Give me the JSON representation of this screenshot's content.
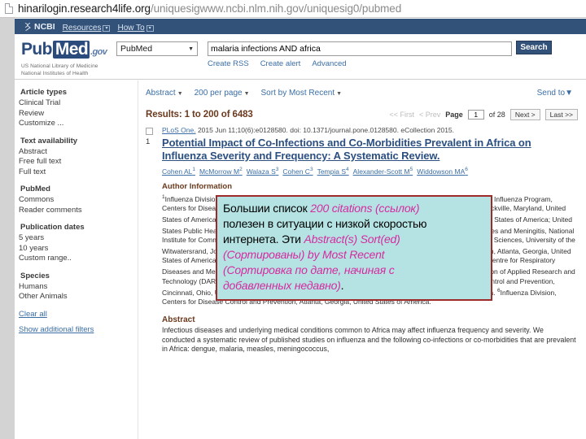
{
  "browser": {
    "url_strong": "hinarilogin.research4life.org",
    "url_dim": "/uniquesigwww.ncbi.nlm.nih.gov/uniquesig0/pubmed",
    "page_icon": "page-icon"
  },
  "ncbi_bar": {
    "logo_text": "NCBI",
    "links": [
      {
        "label": "Resources",
        "caret": "▼"
      },
      {
        "label": "How To",
        "caret": "▼"
      }
    ]
  },
  "header": {
    "logo": {
      "pub": "Pub",
      "med": "Med",
      "gov": ".gov",
      "sub_line1": "US National Library of Medicine",
      "sub_line2": "National Institutes of Health"
    },
    "database_select": {
      "value": "PubMed",
      "caret": "▼"
    },
    "search": {
      "value": "malaria infections AND africa",
      "placeholder": "Search PubMed"
    },
    "search_button": "Search",
    "sub_links": [
      "Create RSS",
      "Create alert",
      "Advanced"
    ]
  },
  "sidebar": {
    "groups": [
      {
        "heading": "Article types",
        "items": [
          "Clinical Trial",
          "Review",
          "Customize ..."
        ]
      },
      {
        "heading": "Text availability",
        "items": [
          "Abstract",
          "Free full text",
          "Full text"
        ]
      },
      {
        "heading": "PubMed",
        "items": [
          "Commons",
          "Reader comments"
        ]
      },
      {
        "heading": "Publication dates",
        "items": [
          "5 years",
          "10 years",
          "Custom range.."
        ]
      },
      {
        "heading": "Species",
        "items": [
          "Humans",
          "Other Animals"
        ]
      }
    ],
    "clear_all": "Clear all",
    "show_additional": "Show additional filters"
  },
  "toolbar": {
    "display_format": "Abstract",
    "per_page": "200 per page",
    "sort_by": "Sort by Most Recent",
    "send_to": "Send to",
    "caret": "▼"
  },
  "results": {
    "count_text": "Results: 1 to 200 of 6483",
    "pager": {
      "first": "<< First",
      "prev": "< Prev",
      "page_label": "Page",
      "page_value": "1",
      "of_text": "of 28",
      "next": "Next >",
      "last": "Last >>"
    }
  },
  "article": {
    "number": "1",
    "journal_name": "PLoS One.",
    "journal_rest": " 2015 Jun 11;10(6):e0128580. doi: 10.1371/journal.pone.0128580. eCollection 2015.",
    "title": "Potential Impact of Co-Infections and Co-Morbidities Prevalent in Africa on Influenza Severity and Frequency: A Systematic Review.",
    "authors": [
      {
        "name": "Cohen AL",
        "sup": "1"
      },
      {
        "name": "McMorrow M",
        "sup": "2"
      },
      {
        "name": "Walaza S",
        "sup": "3"
      },
      {
        "name": "Cohen C",
        "sup": "3"
      },
      {
        "name": "Tempia S",
        "sup": "4"
      },
      {
        "name": "Alexander-Scott M",
        "sup": "5"
      },
      {
        "name": "Widdowson MA",
        "sup": "6"
      }
    ],
    "author_info_heading": "Author Information",
    "affiliations": [
      {
        "sup": "1",
        "text": "Influenza Division, Centers for Disease Control and Prevention, Atlanta, Georgia, United States of America; Influenza Program, Centers for Disease Control and Prevention, Pretoria, South Africa; United States Public Health Service, Rockville, Maryland, United States of America."
      },
      {
        "sup": "2",
        "text": "Influenza Division, Centers for Disease Control and Prevention, Atlanta, Georgia, United States of America; United States Public Health Service, Rockville, Maryland, United States of America."
      },
      {
        "sup": "3",
        "text": "Centre for Respiratory Diseases and Meningitis, National Institute for Communicable Diseases, Sandringham, South Africa; School of Public Health, Faculty of Health Sciences, University of the Witwatersrand, Johannesburg, South Africa."
      },
      {
        "sup": "4",
        "text": "Influenza Division, Centers for Disease Control and Prevention, Atlanta, Georgia, United States of America; Influenza Program, Centers for Disease Control and Prevention, Pretoria, South Africa; Centre for Respiratory Diseases and Meningitis, National Institute for Communicable Diseases, Sandringham, South Africa."
      },
      {
        "sup": "5",
        "text": "Division of Applied Research and Technology (DART), National Institute for Occupational Safety and Health (NIOSH), Centers for Disease Control and Prevention, Cincinnati, Ohio, United States of America; University of Illinois, Springfield, Illinois, United States of America."
      },
      {
        "sup": "6",
        "text": "Influenza Division, Centers for Disease Control and Prevention, Atlanta, Georgia, United States of America."
      }
    ],
    "abstract_heading": "Abstract",
    "abstract_text": "Infectious diseases and underlying medical conditions common to Africa may affect influenza frequency and severity. We conducted a systematic review of published studies on influenza and the following co-infections or co-morbidities that are prevalent in Africa: dengue, malaria, measles, meningococcus,"
  },
  "callout": {
    "line1_plain": "Большии список ",
    "line1_hl": "200 citations (ссылок)",
    "line2_plain": "полезен в ситуации с низкой скоростью",
    "line3_plain": "интернета.  Эти ",
    "line3_hl": "Abstract(s) Sort(ed)",
    "line4_hl": "(Сортированы) by Most Recent",
    "line5_hl": "(Сортировка по дате, начиная с",
    "line6_hl": "добавленных недавно)",
    "line6_plain": ".",
    "border_color": "#9e2a2a",
    "background_color": "#b5e3e3",
    "highlight_color": "#d42ba0"
  }
}
